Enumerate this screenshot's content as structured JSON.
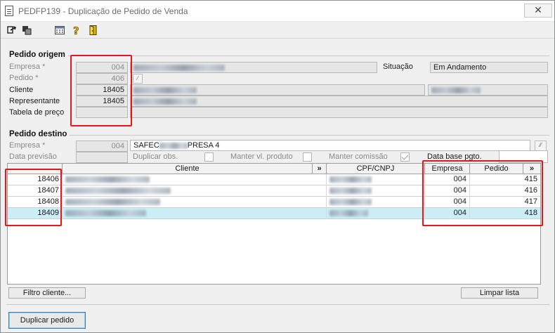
{
  "window": {
    "title": "PEDFP139 - Duplicação de Pedido de Venda",
    "close": "✕"
  },
  "toolbar": {
    "icons": [
      "arrow-out-icon",
      "grid-copy-icon",
      "calculator-icon",
      "help-icon",
      "exit-door-icon"
    ]
  },
  "origem": {
    "section_title": "Pedido origem",
    "empresa_label": "Empresa *",
    "empresa_value": "004",
    "pedido_label": "Pedido *",
    "pedido_value": "406",
    "cliente_label": "Cliente",
    "cliente_value": "18405",
    "representante_label": "Representante",
    "representante_value": "18405",
    "tabela_label": "Tabela de preço",
    "situacao_label": "Situação",
    "situacao_value": "Em Andamento"
  },
  "destino": {
    "section_title": "Pedido destino",
    "empresa_label": "Empresa *",
    "empresa_value": "004",
    "empresa_name_start": "SAFEC",
    "empresa_name_end": "PRESA 4",
    "data_previsao_label": "Data previsão",
    "duplicar_obs_label": "Duplicar obs.",
    "manter_vl_label": "Manter vl. produto",
    "manter_comissao_label": "Manter comissão",
    "manter_comissao_checked": true,
    "data_base_label": "Data base pgto.",
    "data_base_value": ""
  },
  "grid": {
    "headers": {
      "cliente": "Cliente",
      "expand": "»",
      "cpf": "CPF/CNPJ",
      "empresa": "Empresa",
      "pedido": "Pedido",
      "expand2": "»"
    },
    "rows": [
      {
        "code": "18406",
        "empresa": "004",
        "pedido": "415",
        "selected": false
      },
      {
        "code": "18407",
        "empresa": "004",
        "pedido": "416",
        "selected": false
      },
      {
        "code": "18408",
        "empresa": "004",
        "pedido": "417",
        "selected": false
      },
      {
        "code": "18409",
        "empresa": "004",
        "pedido": "418",
        "selected": true
      }
    ]
  },
  "buttons": {
    "filtro_cliente": "Filtro cliente...",
    "limpar_lista": "Limpar lista",
    "duplicar_pedido": "Duplicar pedido"
  },
  "colors": {
    "highlight": "#e8161b",
    "selected_row": "#cbeef7",
    "primary_border": "#3c7fb1"
  }
}
